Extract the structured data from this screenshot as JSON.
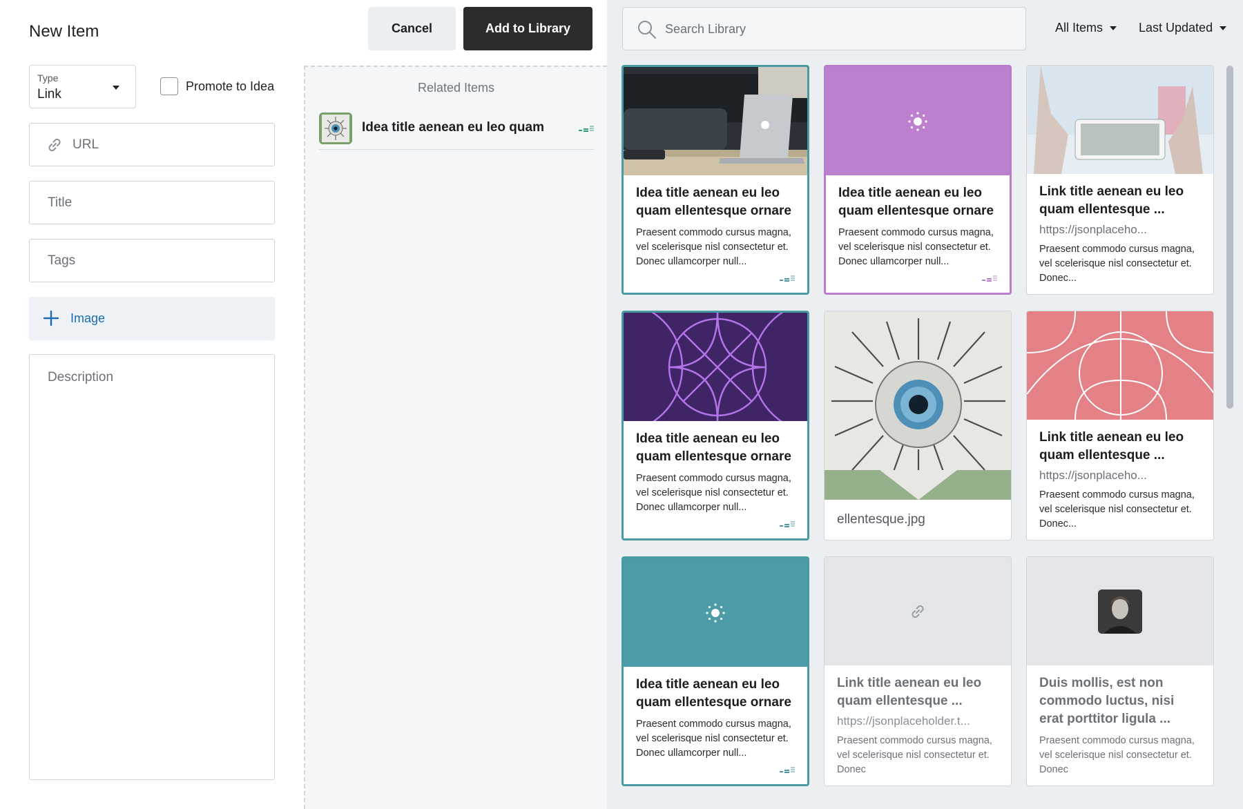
{
  "form": {
    "title": "New Item",
    "type_label": "Type",
    "type_value": "Link",
    "promote_label": "Promote to Idea",
    "promote_checked": false,
    "url_placeholder": "URL",
    "title_placeholder": "Title",
    "tags_placeholder": "Tags",
    "image_label": "Image",
    "description_placeholder": "Description"
  },
  "actions": {
    "cancel_label": "Cancel",
    "add_label": "Add to Library"
  },
  "related": {
    "heading": "Related Items",
    "items": [
      {
        "title": "Idea title aenean eu leo quam",
        "thumb_icon": "eye-collage-thumbnail"
      }
    ]
  },
  "library": {
    "search_placeholder": "Search Library",
    "filter_label": "All Items",
    "sort_label": "Last Updated",
    "cards": [
      {
        "kind": "idea",
        "accent": "#4a9aa3",
        "media": "laptop-photo",
        "title": "Idea title aenean eu leo quam ellentesque ornare",
        "desc": "Praesent commodo cursus magna, vel scelerisque nisl consectetur et. Donec ullamcorper null..."
      },
      {
        "kind": "idea",
        "accent": "#b97bcd",
        "media": "spinner-icon",
        "title": "Idea title aenean eu leo quam ellentesque ornare",
        "desc": "Praesent commodo cursus magna, vel scelerisque nisl consectetur et. Donec ullamcorper null..."
      },
      {
        "kind": "link",
        "media": "phone-photo",
        "title": "Link title aenean eu leo quam ellentesque ...",
        "url": "https://jsonplaceho...",
        "desc": "Praesent commodo cursus magna, vel scelerisque nisl consectetur et. Donec..."
      },
      {
        "kind": "idea",
        "accent": "#4a9aa3",
        "media": "purple-geometric-pattern",
        "title": "Idea title aenean eu leo quam ellentesque ornare",
        "desc": "Praesent commodo cursus magna, vel scelerisque nisl consectetur et. Donec ullamcorper null..."
      },
      {
        "kind": "file",
        "media": "eye-collage-image",
        "filename": "ellentesque.jpg"
      },
      {
        "kind": "link",
        "media": "pink-geometric-pattern",
        "title": "Link title aenean eu leo quam ellentesque ...",
        "url": "https://jsonplaceho...",
        "desc": "Praesent commodo cursus magna, vel scelerisque nisl consectetur et. Donec..."
      },
      {
        "kind": "idea",
        "accent": "#4a9aa3",
        "media": "spinner-icon",
        "title": "Idea title aenean eu leo quam ellentesque ornare",
        "desc": "Praesent commodo cursus magna, vel scelerisque nisl consectetur et. Donec ullamcorper null..."
      },
      {
        "kind": "link",
        "media": "link-icon",
        "title": "Link title aenean eu leo quam ellentesque ...",
        "url": "https://jsonplaceholder.t...",
        "desc": "Praesent commodo cursus magna, vel scelerisque nisl consectetur et. Donec"
      },
      {
        "kind": "person",
        "media": "avatar-photo",
        "title": "Duis mollis, est non commodo luctus, nisi erat porttitor ligula ...",
        "desc": "Praesent commodo cursus magna, vel scelerisque nisl consectetur et. Donec"
      }
    ]
  },
  "colors": {
    "idea_teal": "#4a9aa3",
    "idea_purple": "#b97bcd",
    "primary_button": "#2c2c2e",
    "link_blue": "#1c6bb0"
  }
}
